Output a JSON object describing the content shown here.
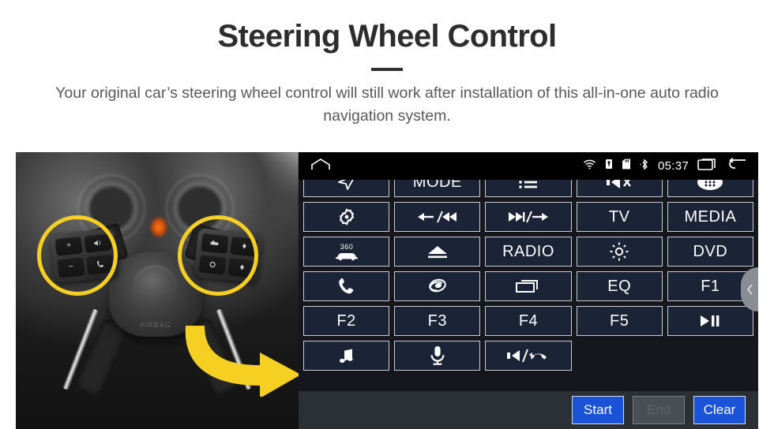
{
  "header": {
    "title": "Steering Wheel Control",
    "subtitle": "Your original car’s steering wheel control will still work after installation of this all-in-one auto radio navigation system."
  },
  "photo": {
    "alt": "steering-wheel-with-highlighted-control-clusters",
    "hub_text": "AIRBAG",
    "left_cluster_keys": [
      "+",
      "mute-icon",
      "−",
      "phone-icon"
    ],
    "right_cluster_keys": [
      "source-icon",
      "up-icon",
      "circle-icon",
      "down-icon"
    ],
    "highlight_color": "#f5cf21",
    "arrow_color": "#f5cf21"
  },
  "head_unit": {
    "statusbar": {
      "home_icon": "home-icon",
      "wifi_icon": "wifi-icon",
      "usb_icon": "usb-lock-icon",
      "sd_icon": "sd-card-icon",
      "bluetooth_icon": "bluetooth-icon",
      "time": "05:37",
      "recents_icon": "recent-apps-icon",
      "back_icon": "back-arrow-icon"
    },
    "buttons": [
      [
        {
          "name": "navigation",
          "type": "icon",
          "icon": "navigation-arrow-icon",
          "label": ""
        },
        {
          "name": "mode",
          "type": "text",
          "icon": "",
          "label": "MODE"
        },
        {
          "name": "list",
          "type": "icon",
          "icon": "list-icon",
          "label": ""
        },
        {
          "name": "mute",
          "type": "icon",
          "icon": "mute-icon",
          "label": ""
        },
        {
          "name": "apps",
          "type": "icon",
          "icon": "apps-grid-icon",
          "label": ""
        }
      ],
      [
        {
          "name": "settings",
          "type": "icon",
          "icon": "gear-dot-icon",
          "label": ""
        },
        {
          "name": "previous",
          "type": "icon",
          "icon": "prev-track-icon",
          "label": ""
        },
        {
          "name": "next",
          "type": "icon",
          "icon": "next-track-icon",
          "label": ""
        },
        {
          "name": "tv",
          "type": "text",
          "icon": "",
          "label": "TV"
        },
        {
          "name": "media",
          "type": "text",
          "icon": "",
          "label": "MEDIA"
        }
      ],
      [
        {
          "name": "camera-360",
          "type": "icon",
          "icon": "car-360-icon",
          "label": "360"
        },
        {
          "name": "eject",
          "type": "icon",
          "icon": "eject-icon",
          "label": ""
        },
        {
          "name": "radio",
          "type": "text",
          "icon": "",
          "label": "RADIO"
        },
        {
          "name": "brightness",
          "type": "icon",
          "icon": "brightness-sun-icon",
          "label": ""
        },
        {
          "name": "dvd",
          "type": "text",
          "icon": "",
          "label": "DVD"
        }
      ],
      [
        {
          "name": "phone",
          "type": "icon",
          "icon": "phone-icon",
          "label": ""
        },
        {
          "name": "bluetooth-swirl",
          "type": "icon",
          "icon": "swirl-icon",
          "label": ""
        },
        {
          "name": "window",
          "type": "icon",
          "icon": "window-stack-icon",
          "label": ""
        },
        {
          "name": "eq",
          "type": "text",
          "icon": "",
          "label": "EQ"
        },
        {
          "name": "f1",
          "type": "text",
          "icon": "",
          "label": "F1"
        }
      ],
      [
        {
          "name": "f2",
          "type": "text",
          "icon": "",
          "label": "F2"
        },
        {
          "name": "f3",
          "type": "text",
          "icon": "",
          "label": "F3"
        },
        {
          "name": "f4",
          "type": "text",
          "icon": "",
          "label": "F4"
        },
        {
          "name": "f5",
          "type": "text",
          "icon": "",
          "label": "F5"
        },
        {
          "name": "play-pause",
          "type": "icon",
          "icon": "play-pause-icon",
          "label": ""
        }
      ],
      [
        {
          "name": "music",
          "type": "icon",
          "icon": "music-note-icon",
          "label": ""
        },
        {
          "name": "voice",
          "type": "icon",
          "icon": "microphone-icon",
          "label": ""
        },
        {
          "name": "volume-hangup",
          "type": "icon",
          "icon": "volume-hangup-icon",
          "label": ""
        },
        {
          "name": "empty-1",
          "type": "blank",
          "icon": "",
          "label": ""
        },
        {
          "name": "empty-2",
          "type": "blank",
          "icon": "",
          "label": ""
        }
      ]
    ],
    "actions": [
      {
        "name": "start",
        "label": "Start",
        "disabled": false
      },
      {
        "name": "end",
        "label": "End",
        "disabled": true
      },
      {
        "name": "clear",
        "label": "Clear",
        "disabled": false
      }
    ],
    "drawer_tab_icon": "chevron-left-icon",
    "colors": {
      "button_face": "#1b2436",
      "button_border": "#c9ccd4",
      "panel_bg": "#15171c",
      "bottom_bar": "#2b2f36",
      "action_blue": "#1a52d8",
      "action_disabled": "#4a4e55"
    }
  }
}
